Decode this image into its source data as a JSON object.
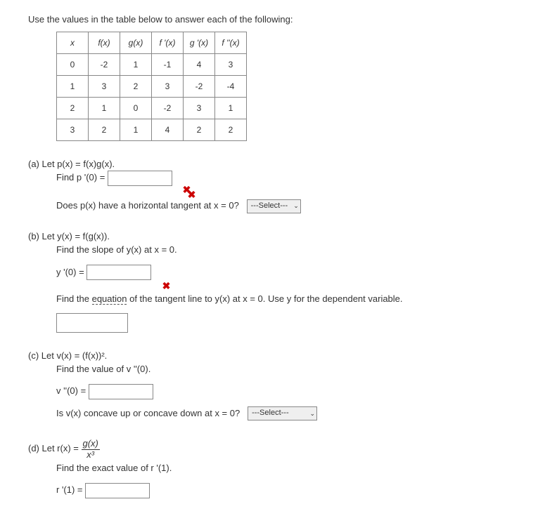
{
  "intro": "Use the values in the table below to answer each of the following:",
  "table": {
    "headers": [
      "x",
      "f(x)",
      "g(x)",
      "f '(x)",
      "g '(x)",
      "f ''(x)"
    ],
    "rows": [
      [
        "0",
        "-2",
        "1",
        "-1",
        "4",
        "3"
      ],
      [
        "1",
        "3",
        "2",
        "3",
        "-2",
        "-4"
      ],
      [
        "2",
        "1",
        "0",
        "-2",
        "3",
        "1"
      ],
      [
        "3",
        "2",
        "1",
        "4",
        "2",
        "2"
      ]
    ]
  },
  "a": {
    "label": "(a) Let p(x) = f(x)g(x).",
    "find": "Find p '(0) = ",
    "does": "Does p(x) have a horizontal tangent at x = 0?",
    "select": "---Select---"
  },
  "b": {
    "label": "(b) Let y(x) = f(g(x)).",
    "find_slope": "Find the slope of y(x) at x = 0.",
    "yprime": "y '(0) = ",
    "find_eq_pre": "Find the ",
    "find_eq_link": "equation",
    "find_eq_post": " of the tangent line to y(x) at x = 0. Use y for the dependent variable."
  },
  "c": {
    "label": "(c) Let v(x) = (f(x))².",
    "find": "Find the value of v ''(0).",
    "vpp": "v ''(0) = ",
    "concave": "Is v(x) concave up or concave down at x = 0?",
    "select": "---Select---"
  },
  "d": {
    "label_pre": "(d) Let  r(x) = ",
    "frac_num": "g(x)",
    "frac_den": "x³",
    "find": "Find the exact value of r '(1).",
    "rprime": "r '(1) = "
  },
  "x_mark": "✖"
}
